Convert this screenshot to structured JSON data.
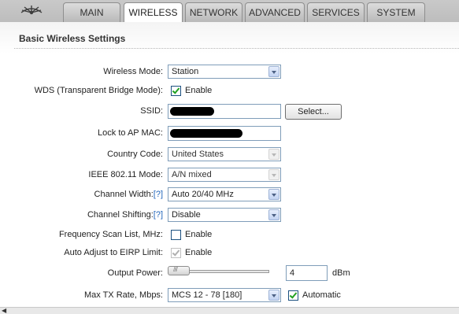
{
  "nav": {
    "tabs": [
      "MAIN",
      "WIRELESS",
      "NETWORK",
      "ADVANCED",
      "SERVICES",
      "SYSTEM"
    ],
    "active_tab": "WIRELESS"
  },
  "page": {
    "section_title": "Basic Wireless Settings"
  },
  "form": {
    "wireless_mode": {
      "label": "Wireless Mode:",
      "value": "Station"
    },
    "wds": {
      "label": "WDS (Transparent Bridge Mode):",
      "checkbox_label": "Enable",
      "checked": true
    },
    "ssid": {
      "label": "SSID:",
      "button": "Select..."
    },
    "lock_ap_mac": {
      "label": "Lock to AP MAC:"
    },
    "country_code": {
      "label": "Country Code:",
      "value": "United States"
    },
    "ieee_mode": {
      "label": "IEEE 802.11 Mode:",
      "value": "A/N mixed"
    },
    "channel_width": {
      "label": "Channel Width:",
      "help": "[?]",
      "value": "Auto 20/40 MHz"
    },
    "channel_shifting": {
      "label": "Channel Shifting:",
      "help": "[?]",
      "value": "Disable"
    },
    "freq_scan": {
      "label": "Frequency Scan List, MHz:",
      "checkbox_label": "Enable",
      "checked": false
    },
    "auto_adjust": {
      "label": "Auto Adjust to EIRP Limit:",
      "checkbox_label": "Enable",
      "checked": true
    },
    "output_power": {
      "label": "Output Power:",
      "value": "4",
      "unit": "dBm",
      "slider_level": 0.0
    },
    "max_tx_rate": {
      "label": "Max TX Rate, Mbps:",
      "value": "MCS 12 - 78 [180]",
      "checkbox_label": "Automatic",
      "checked": true
    }
  },
  "colors": {
    "help_link": "#2266bb",
    "check_mark": "#21a121",
    "top_bar": "#c4c4c4"
  },
  "icons": [
    "ubiquiti-logo-icon",
    "dropdown-arrow-icon",
    "checkbox-check-icon",
    "scroll-left-arrow-icon"
  ]
}
